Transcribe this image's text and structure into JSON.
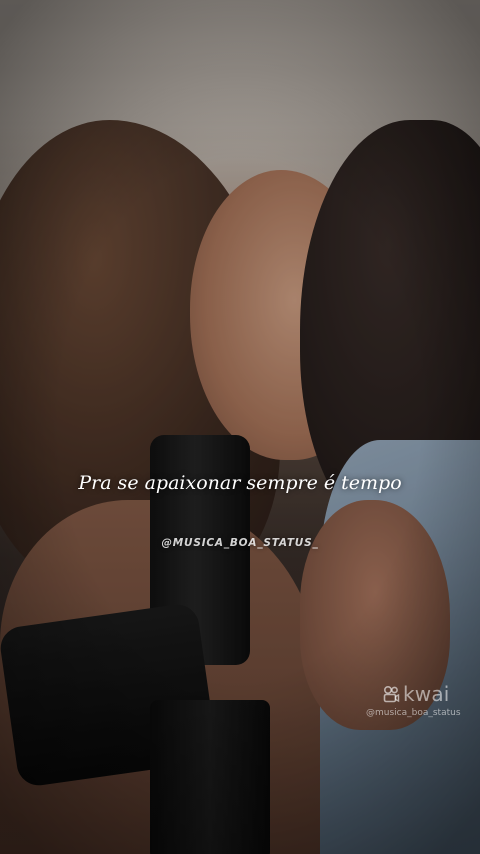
{
  "video": {
    "lyric": "Pra se apaixonar sempre é tempo",
    "channel_handle": "@MUSICA_BOA_STATUS_"
  },
  "watermark": {
    "brand": "kwai",
    "username": "@musica_boa_status",
    "icon": "kwai-logo-icon"
  }
}
